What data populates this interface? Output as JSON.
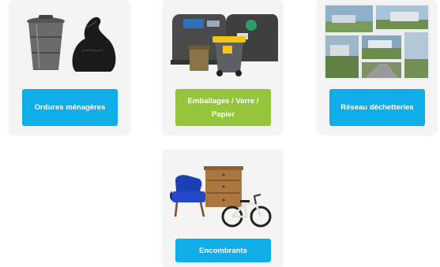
{
  "cards": [
    {
      "label": "Ordures ménagères",
      "image": "trash-bin-and-bag",
      "button_color": "#10aee8"
    },
    {
      "label": "Emballages / Verre / Papier",
      "image": "recycling-containers",
      "button_color": "#95c43d"
    },
    {
      "label": "Réseau déchetteries",
      "image": "recycling-centers-photos",
      "button_color": "#10aee8"
    },
    {
      "label": "Encombrants",
      "image": "bulky-items",
      "button_color": "#10aee8"
    }
  ]
}
